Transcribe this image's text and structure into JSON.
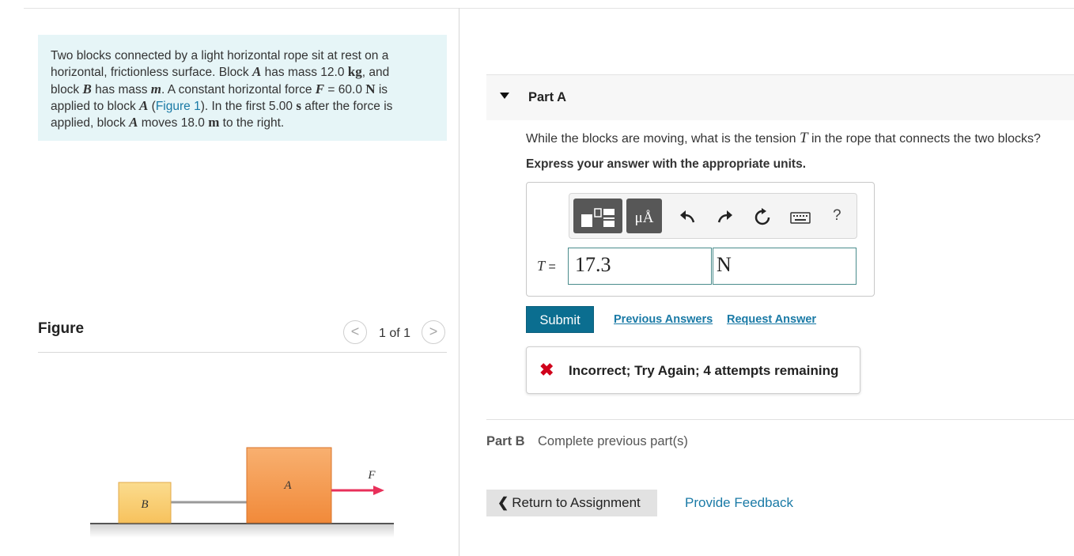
{
  "problem": {
    "line1": "Two blocks connected by a light horizontal rope sit at rest on a",
    "line2a": "horizontal, frictionless surface. Block ",
    "blockA": "A",
    "line2b": " has mass 12.0 ",
    "kg": "kg",
    "line2c": ", and",
    "line3a": "block ",
    "blockB": "B",
    "line3b": " has mass ",
    "m": "m",
    "line3c": ". A constant horizontal force ",
    "F": "F",
    "line3d": " = 60.0 ",
    "N": "N",
    "line3e": " is",
    "line4a": "applied to block ",
    "line4b": " (",
    "figure_link": "Figure 1",
    "line4c": "). In the first 5.00 ",
    "s": "s",
    "line4d": " after the force is",
    "line5a": "applied, block ",
    "line5b": " moves 18.0 ",
    "meter": "m",
    "line5c": " to the right."
  },
  "figure": {
    "title": "Figure",
    "count": "1 of 1",
    "prev": "<",
    "next": ">",
    "label_B": "B",
    "label_A": "A",
    "label_F": "F"
  },
  "partA": {
    "label": "Part A",
    "question_a": "While the blocks are moving, what is the tension ",
    "question_T": "T",
    "question_b": " in the rope that connects the two blocks?",
    "instruction": "Express your answer with the appropriate units.",
    "units_btn": "μÅ",
    "help": "?",
    "answer_label_T": "T",
    "answer_label_eq": " =",
    "value": "17.3",
    "unit": "N",
    "submit": "Submit",
    "previous_answers": "Previous Answers",
    "request_answer": "Request Answer",
    "feedback_icon": "✖",
    "feedback": "Incorrect; Try Again; 4 attempts remaining"
  },
  "partB": {
    "label": "Part B",
    "status": "Complete previous part(s)"
  },
  "footer": {
    "return_chevron": "❮",
    "return": "Return to Assignment",
    "provide_feedback": "Provide Feedback"
  },
  "colors": {
    "accent": "#0b6e90",
    "link": "#1a7aa6",
    "problem_bg": "#e6f5f7",
    "error": "#d0021b",
    "block_A": "#f39a4e",
    "block_B": "#f9d07a",
    "force_arrow": "#e8305a"
  }
}
